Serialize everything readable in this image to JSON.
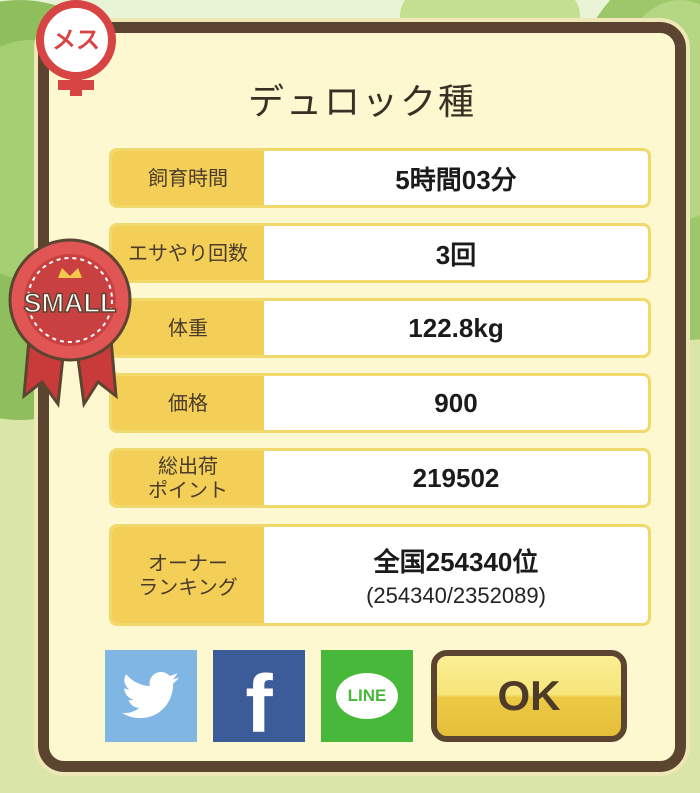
{
  "title": "デュロック種",
  "badge_female": "メス",
  "ribbon_text": "SMALL",
  "rows": [
    {
      "label": "飼育時間",
      "value": "5時間03分"
    },
    {
      "label": "エサやり回数",
      "value": "3回"
    },
    {
      "label": "体重",
      "value": "122.8kg"
    },
    {
      "label": "価格",
      "value": "900"
    },
    {
      "label": "総出荷\nポイント",
      "value": "219502"
    },
    {
      "label": "オーナー\nランキング",
      "value": "全国254340位",
      "sub": "(254340/2352089)"
    }
  ],
  "share": {
    "line_label": "LINE",
    "facebook_label": "f"
  },
  "ok_label": "OK",
  "colors": {
    "frame": "#5b4530",
    "panel": "#fdf8cf",
    "label_bg": "#f3cf58",
    "twitter": "#7fb6e4",
    "facebook": "#3b5b99",
    "line": "#48b83a",
    "ribbon": "#d84a4a"
  }
}
